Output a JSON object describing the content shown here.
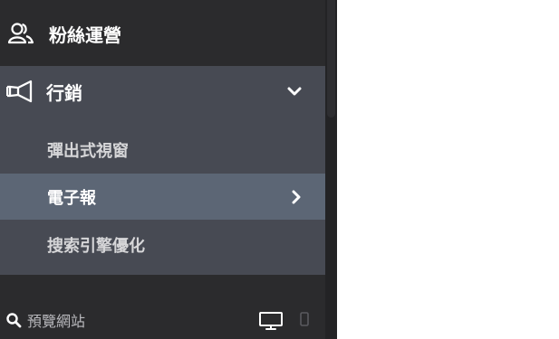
{
  "sidebar": {
    "fans_ops": {
      "label": "粉絲運營",
      "icon": "people-icon"
    },
    "marketing": {
      "label": "行銷",
      "icon": "megaphone-icon",
      "expanded": true,
      "items": [
        {
          "label": "彈出式視窗",
          "active": false
        },
        {
          "label": "電子報",
          "active": true
        },
        {
          "label": "搜索引擎優化",
          "active": false
        }
      ]
    },
    "preview": {
      "label": "預覽網站",
      "icon": "search-icon"
    },
    "device_toggle": {
      "options": [
        "desktop",
        "mobile"
      ],
      "selected": "desktop"
    }
  },
  "colors": {
    "sidebar_bg": "#2b2b2d",
    "group_bg": "#474a53",
    "active_item_bg": "#5c6675",
    "text": "#ffffff"
  }
}
